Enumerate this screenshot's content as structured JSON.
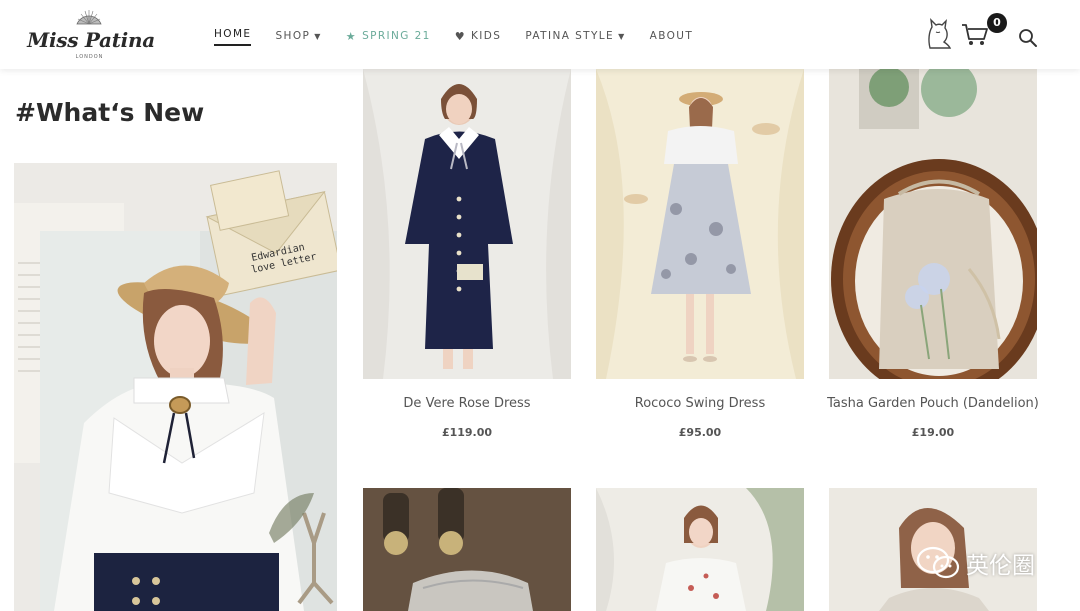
{
  "brand": {
    "name": "Miss Patina",
    "sub": "LONDON"
  },
  "nav": {
    "home": "HOME",
    "shop": "SHOP",
    "spring": "SPRING 21",
    "kids": "KIDS",
    "patina_style": "PATINA STYLE",
    "about": "ABOUT"
  },
  "cart": {
    "count": "0"
  },
  "section": {
    "title": "#What‘s New"
  },
  "feature": {
    "envelope_text_1": "Edwardian",
    "envelope_text_2": "love letter"
  },
  "products": [
    {
      "name": "De Vere Rose Dress",
      "price": "£119.00"
    },
    {
      "name": "Rococo Swing Dress",
      "price": "£95.00"
    },
    {
      "name": "Tasha Garden Pouch (Dandelion)",
      "price": "£19.00"
    }
  ],
  "watermark": {
    "text": "英伦圈"
  },
  "colors": {
    "accent": "#6bab9a",
    "text": "#555555",
    "badge": "#1a1a1a"
  },
  "icons": [
    "fan-logo-icon",
    "star-icon",
    "heart-icon",
    "caret-down-icon",
    "cat-icon",
    "cart-icon",
    "search-icon",
    "wechat-icon"
  ]
}
